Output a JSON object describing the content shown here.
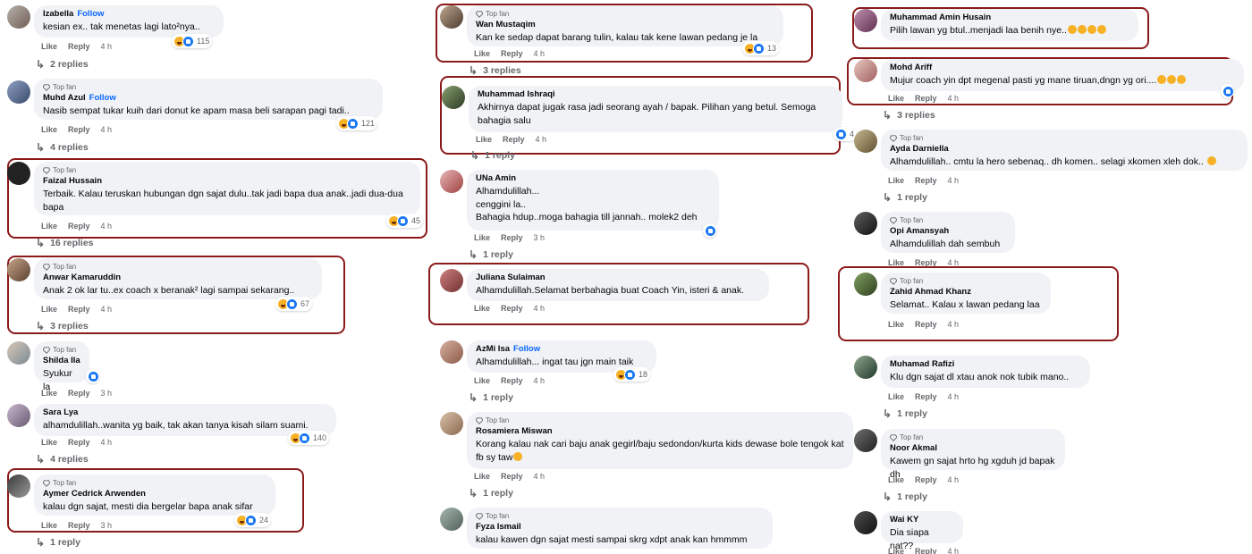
{
  "labels": {
    "like": "Like",
    "reply": "Reply",
    "top_fan": "Top fan",
    "follow": "Follow"
  },
  "colors": {
    "highlight": "#8b1a1a",
    "bubble": "#f0f2f5",
    "link": "#0866ff",
    "muted": "#65676b"
  },
  "comments": [
    {
      "author": "Izabella",
      "follow": true,
      "text": "kesian ex.. tak menetas lagi lato²nya..",
      "time": "4 h",
      "reactions": "115",
      "replies": "2 replies"
    },
    {
      "author": "Muhd Azul",
      "top_fan": true,
      "follow": true,
      "text": "Nasib sempat tukar kuih dari donut ke apam masa beli sarapan pagi tadi..",
      "time": "4 h",
      "reactions": "121",
      "replies": "4 replies"
    },
    {
      "author": "Faizal Hussain",
      "top_fan": true,
      "text": "Terbaik. Kalau teruskan hubungan dgn sajat dulu..tak jadi bapa dua anak..jadi dua-dua bapa",
      "time": "4 h",
      "reactions": "45",
      "replies": "16 replies"
    },
    {
      "author": "Anwar Kamaruddin",
      "top_fan": true,
      "text": "Anak 2 ok lar tu..ex coach x beranak² lagi sampai sekarang..",
      "time": "4 h",
      "reactions": "67",
      "replies": "3 replies"
    },
    {
      "author": "Shilda Ila",
      "top_fan": true,
      "text": "Syukur la",
      "time": "3 h"
    },
    {
      "author": "Sara Lya",
      "text": "alhamdulillah..wanita yg baik, tak akan tanya kisah silam suami.",
      "time": "4 h",
      "reactions": "140",
      "replies": "4 replies"
    },
    {
      "author": "Aymer Cedrick Arwenden",
      "top_fan": true,
      "text": "kalau dgn sajat, mesti dia bergelar bapa anak sifar",
      "time": "3 h",
      "reactions": "24",
      "replies": "1 reply"
    },
    {
      "author": "Wan Mustaqim",
      "top_fan": true,
      "text": "Kan ke sedap dapat barang tulin, kalau tak kene lawan pedang je la",
      "time": "4 h",
      "reactions": "13",
      "replies": "3 replies"
    },
    {
      "author": "Muhammad Ishraqi",
      "text": "Akhirnya dapat jugak rasa jadi seorang ayah / bapak. Pilihan yang betul. Semoga bahagia salu",
      "time": "4 h",
      "reactions": "4",
      "replies": "1 reply"
    },
    {
      "author": "UNa Amin",
      "text": "Alhamdulillah...\ncenggini la..\nBahagia hdup..moga bahagia till jannah.. molek2 deh",
      "time": "3 h",
      "replies": "1 reply"
    },
    {
      "author": "Juliana Sulaiman",
      "text": "Alhamdulillah.Selamat berbahagia buat Coach Yin, isteri & anak.",
      "time": "4 h"
    },
    {
      "author": "AzMi Isa",
      "follow": true,
      "text": "Alhamdulillah... ingat tau jgn main taik",
      "time": "4 h",
      "reactions": "18",
      "replies": "1 reply"
    },
    {
      "author": "Rosamiera Miswan",
      "top_fan": true,
      "text": "Korang kalau nak cari baju anak gegirl/baju sedondon/kurta kids dewase bole tengok kat fb sy taw",
      "time": "4 h",
      "replies": "1 reply"
    },
    {
      "author": "Fyza Ismail",
      "top_fan": true,
      "text": "kalau kawen dgn sajat mesti sampai skrg xdpt anak kan hmmmm"
    },
    {
      "author": "Muhammad Amin Husain",
      "text": "Pilih lawan yg btul..menjadi laa benih nye.."
    },
    {
      "author": "Mohd Ariff",
      "text": "Mujur coach yin dpt megenal pasti yg mane tiruan,dngn yg ori....",
      "time": "4 h",
      "replies": "3 replies"
    },
    {
      "author": "Ayda Darniella",
      "top_fan": true,
      "text": "Alhamdulillah.. cmtu la hero sebenaq.. dh komen.. selagi xkomen xleh dok..",
      "time": "4 h",
      "replies": "1 reply"
    },
    {
      "author": "Opi Amansyah",
      "top_fan": true,
      "text": "Alhamdulillah dah sembuh",
      "time": "4 h"
    },
    {
      "author": "Zahid Ahmad Khanz",
      "top_fan": true,
      "text": "Selamat.. Kalau x lawan pedang laa",
      "time": "4 h"
    },
    {
      "author": "Muhamad Rafizi",
      "text": "Klu dgn sajat dl xtau anok nok tubik mano..",
      "time": "4 h",
      "replies": "1 reply"
    },
    {
      "author": "Noor Akmal",
      "top_fan": true,
      "text": "Kawem gn sajat hrto hg xgduh jd bapak dh",
      "time": "4 h",
      "replies": "1 reply"
    },
    {
      "author": "Wai KY",
      "text": "Dia siapa nat??",
      "time": "4 h"
    }
  ]
}
